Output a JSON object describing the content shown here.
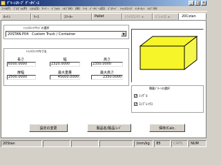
{
  "window": {
    "title": "ｸﾞﾘｰﾝｽﾘｰﾌﾟ ﾃﾞｰﾀﾍﾞｰｽ",
    "minimize": "_",
    "maximize": "□",
    "close": "×"
  },
  "menubar": [
    "ﾌｧｲﾙ(F)",
    "ﾌﾟﾛｸﾞﾗﾑ(P)",
    "ｼｽﾃﾑ(S)",
    "ｻｰﾊﾞｰ",
    "ﾃﾞﾌｫﾙﾄ",
    "ﾍﾙﾌﾟ(H)",
    "(W)",
    "ﾂｰﾙ",
    "ﾃﾞｰﾀﾍﾞｰｽ(D)",
    "ﾊﾟｽﾜｰﾄﾞ",
    "ﾄﾗｯｸ/ｺﾝﾃﾅ",
    "ｲﾝﾀｰﾈｯﾄ",
    "ﾍﾙﾌﾟ(H)"
  ],
  "tabs": [
    {
      "label": "ｶｰﾄﾝ",
      "state": "normal"
    },
    {
      "label": "ｹｰｽ",
      "state": "normal"
    },
    {
      "label": "ｽﾘｰｶｰ",
      "state": "normal"
    },
    {
      "label": "Pallet",
      "state": "normal"
    },
    {
      "label": "ﾄﾗｯｸ/ｺﾝﾃﾅ",
      "state": "disabled"
    },
    {
      "label": "ﾊﾟﾚｯﾄ2",
      "state": "disabled"
    },
    {
      "label": "20Cstan",
      "state": "active"
    }
  ],
  "tab_close": "×",
  "selection": {
    "group_title": "ﾄﾗｯｸ/ｺﾝﾃﾅｻｲｽﾞの選択",
    "selected": "20STAN.P04   Custom Truck / Container",
    "arrow": "▼"
  },
  "dimensions": {
    "group_title": "ﾄﾗｯｸ/ｺﾝﾃﾅ内寸法",
    "length_label": "長さ",
    "length_value": "6500.0000",
    "width_label": "幅",
    "width_value": "2320.0000",
    "height_label": "高さ",
    "height_value": "2350.0000",
    "door_width_label": "扉幅",
    "door_width_value": "2500.0000",
    "max_weight_label": "最大重量",
    "max_weight_value": "45000.0000",
    "max_height_label": "最大高さ",
    "max_height_value": "2350.0000"
  },
  "preview": {
    "box_color": "#f5f52a",
    "edge_color": "#000000"
  },
  "options": {
    "group_title": "積載ﾊﾟﾀｰﾝの選択",
    "items": [
      {
        "label": "ｼﾝｸﾞﾙ",
        "checked": true
      },
      {
        "label": "ｺﾝﾌﾟﾚｯｸｽ",
        "checked": true
      }
    ],
    "check_mark": "✓"
  },
  "buttons": {
    "settings": "設定の変更",
    "product_code": "製品名/製品ｺｰﾄﾞ",
    "save_calc": "保存/Calc."
  },
  "statusbar": [
    "20Stan",
    "",
    "",
    "",
    "(mm/kg",
    "85",
    "CAPS",
    "NUM"
  ]
}
